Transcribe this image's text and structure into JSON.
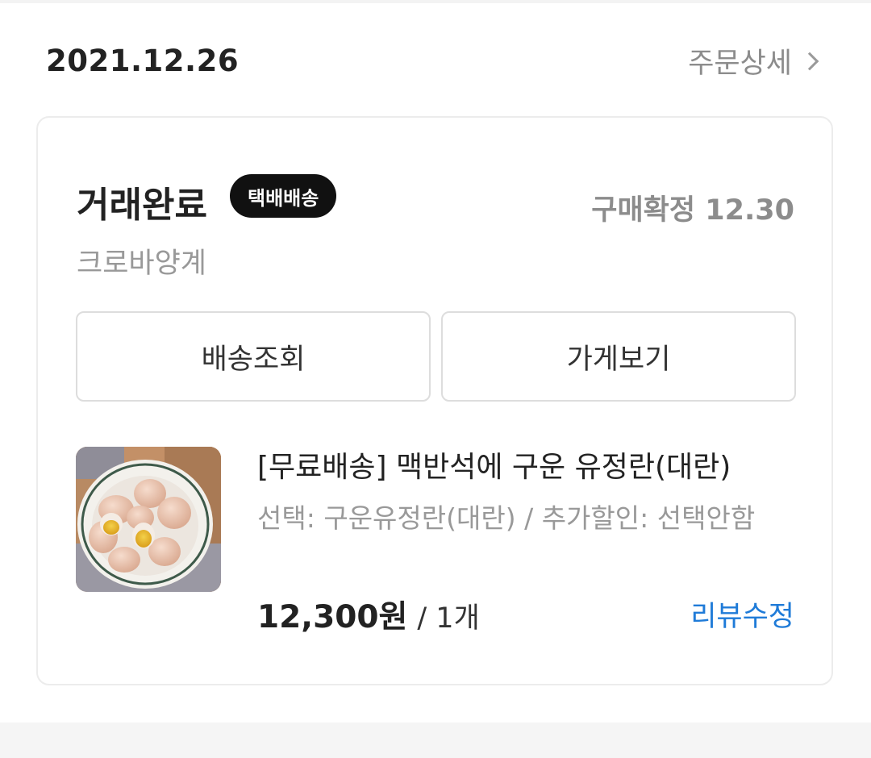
{
  "order": {
    "date": "2021.12.26",
    "detail_label": "주문상세"
  },
  "card": {
    "status": "거래완료",
    "delivery_badge": "택배배송",
    "confirm_label": "구매확정",
    "confirm_date": "12.30",
    "seller": "크로바양계",
    "buttons": {
      "track": "배송조회",
      "store": "가게보기"
    },
    "product": {
      "name": "[무료배송] 맥반석에 구운 유정란(대란)",
      "option": "선택: 구운유정란(대란) / 추가할인: 선택안함",
      "price": "12,300원",
      "quantity": "/ 1개",
      "review_label": "리뷰수정"
    }
  },
  "colors": {
    "review_link": "#1f7bd8",
    "badge_bg": "#111111",
    "muted_text": "#8c8c8c"
  },
  "icons": {
    "detail_chevron": "chevron-right-icon",
    "product_image": "boiled-eggs-photo"
  }
}
